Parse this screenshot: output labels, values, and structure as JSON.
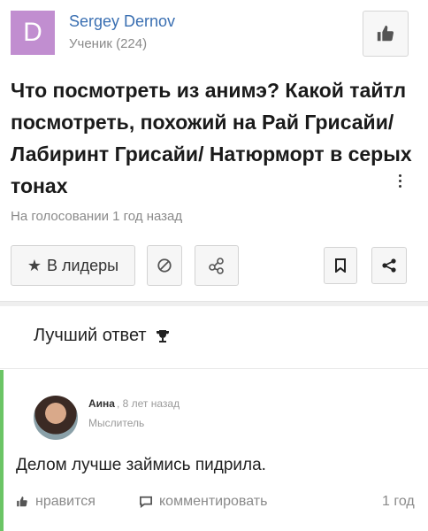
{
  "author": {
    "avatar_letter": "D",
    "avatar_color": "#c18ed0",
    "name": "Sergey Dernov",
    "rank": "Ученик (224)"
  },
  "question": {
    "title": "Что посмотреть из анимэ? Какой тайтл посмотреть, похожий на Рай Грисайи/Лабиринт Грисайи/ Натюрморт в серых тонах",
    "meta": "На голосовании 1 год назад"
  },
  "actions": {
    "leaders_label": "В лидеры"
  },
  "best_answer": {
    "heading": "Лучший ответ",
    "author_name": "Аина",
    "time": ", 8 лет назад",
    "author_rank": "Мыслитель",
    "text": "Делом лучше займись пидрила.",
    "like_label": "нравится",
    "comment_label": "комментировать",
    "age": "1 год"
  },
  "colors": {
    "link": "#3a6fb2",
    "accent_bar": "#6bc565"
  },
  "icons": [
    "thumbs-up-icon",
    "star-icon",
    "ban-icon",
    "share-icon",
    "bookmark-icon",
    "trophy-icon",
    "comment-icon",
    "more-icon"
  ]
}
